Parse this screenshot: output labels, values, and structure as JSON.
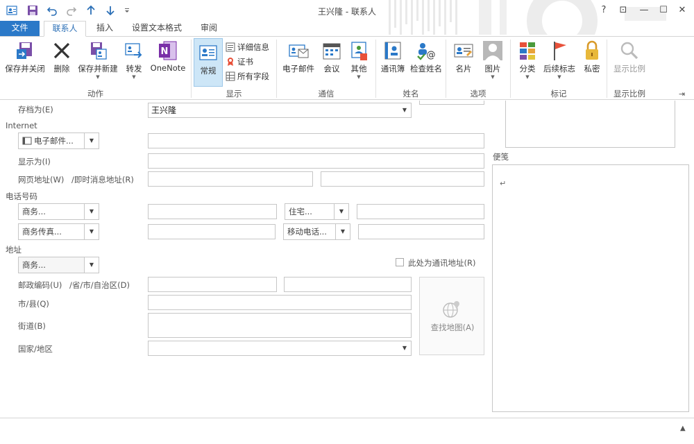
{
  "window": {
    "title": "王兴隆 - 联系人",
    "help": "?",
    "restore_ribbon": "⊡",
    "minimize": "—",
    "maximize": "☐",
    "close": "✕"
  },
  "tabs": [
    "文件",
    "联系人",
    "插入",
    "设置文本格式",
    "审阅"
  ],
  "ribbon": {
    "groups": {
      "actions": "动作",
      "show": "显示",
      "communicate": "通信",
      "names": "姓名",
      "options": "选项",
      "tags": "标记",
      "zoom": "显示比例"
    },
    "buttons": {
      "save_close": "保存并关闭",
      "delete": "删除",
      "save_new": "保存并新建",
      "forward": "转发",
      "onenote": "OneNote",
      "general": "常规",
      "details": "详细信息",
      "certificates": "证书",
      "all_fields": "所有字段",
      "email": "电子邮件",
      "meeting": "会议",
      "more": "其他",
      "address_book": "通讯簿",
      "check_names": "检查姓名",
      "business_card": "名片",
      "picture": "图片",
      "categorize": "分类",
      "follow_up": "后续标志",
      "private": "私密",
      "zoom": "显示比例"
    }
  },
  "form": {
    "file_as_label": "存档为(E)",
    "file_as_value": "王兴隆",
    "internet_section": "Internet",
    "email_btn": "电子邮件...",
    "display_as_label": "显示为(I)",
    "web_label": "网页地址(W)",
    "im_label": "/即时消息地址(R)",
    "phone_section": "电话号码",
    "phone1": "商务...",
    "phone2": "住宅...",
    "phone3": "商务传真...",
    "phone4": "移动电话...",
    "address_section": "地址",
    "address_type": "商务...",
    "mailing_address": "此处为通讯地址(R)",
    "postal_label": "邮政编码(U)",
    "province_label": "/省/市/自治区(D)",
    "city_label": "市/县(Q)",
    "street_label": "街道(B)",
    "country_label": "国家/地区",
    "map_btn": "查找地图(A)",
    "notes_label": "便笺",
    "notes_mark": "↵"
  },
  "colors": {
    "accent": "#2b79c8",
    "selected_bg": "#cde6f7"
  }
}
